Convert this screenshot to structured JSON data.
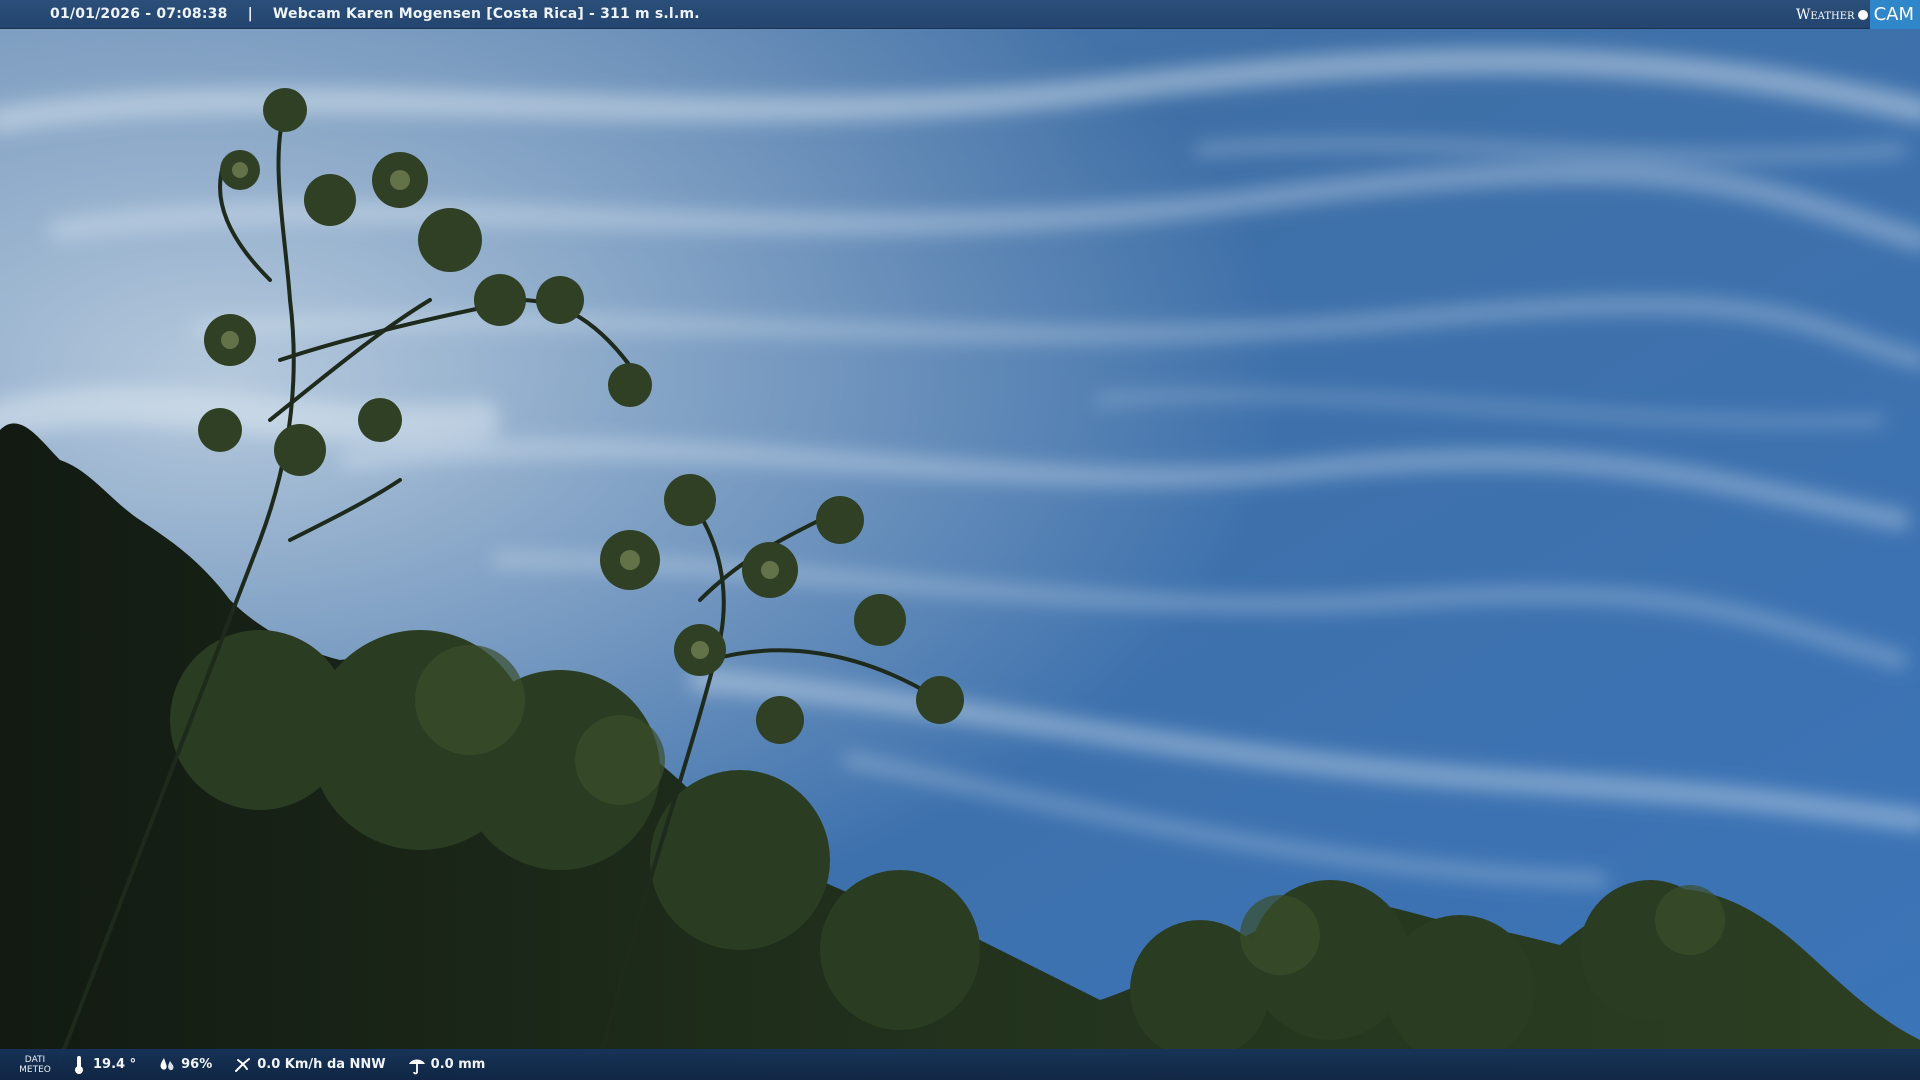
{
  "header": {
    "datetime": "01/01/2026 - 07:08:38",
    "separator": "|",
    "camera_title": "Webcam Karen Mogensen [Costa Rica] - 311 m s.l.m."
  },
  "logo": {
    "weather_text": "Weather",
    "cam_text": "CAM"
  },
  "weather_bar": {
    "label_line1": "DATI",
    "label_line2": "METEO",
    "temperature": "19.4 °",
    "humidity": "96%",
    "wind": "0.0 Km/h da NNW",
    "rain": "0.0 mm"
  },
  "icons": {
    "temperature": "thermometer-icon",
    "humidity": "humidity-drops-icon",
    "wind": "wind-icon",
    "rain": "rain-icon"
  },
  "colors": {
    "sky_top": "#2f5d94",
    "sky_bottom": "#3f77b8",
    "foliage": "#1f2f1c",
    "bar_bg": "#1c3d68",
    "logo_accent": "#2f86c8"
  }
}
